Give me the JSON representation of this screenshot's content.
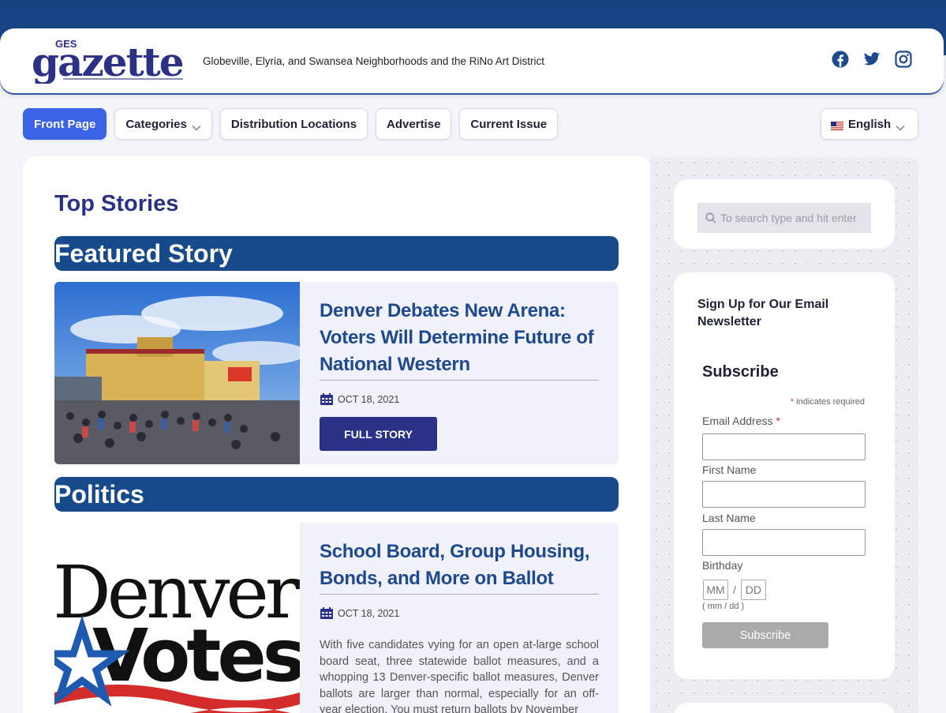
{
  "header": {
    "logo_small": "GES",
    "logo_text": "gazette",
    "tagline": "Globeville, Elyria, and Swansea Neighborhoods and the RiNo Art District",
    "social": [
      "facebook-icon",
      "twitter-icon",
      "instagram-icon"
    ]
  },
  "nav": {
    "items": [
      {
        "label": "Front Page",
        "active": true
      },
      {
        "label": "Categories",
        "dropdown": true
      },
      {
        "label": "Distribution Locations"
      },
      {
        "label": "Advertise"
      },
      {
        "label": "Current Issue"
      }
    ],
    "language": "English"
  },
  "main": {
    "heading": "Top Stories",
    "sections": [
      {
        "title": "Featured Story",
        "headline": "Denver Debates New Arena: Voters Will Determine Future of National Western",
        "date": "OCT 18, 2021",
        "button": "FULL STORY"
      },
      {
        "title": "Politics",
        "headline": "School Board, Group Housing, Bonds, and More on Ballot",
        "date": "OCT 18, 2021",
        "excerpt": "With five candidates vying for an open at-large school board seat, three statewide ballot measures, and a whopping 13 Denver-specific ballot measures, Denver ballots are larger than normal, especially for an off-year election. You must return ballots by November",
        "image_text_1": "Denver",
        "image_text_2": "Votes"
      }
    ]
  },
  "sidebar": {
    "search_placeholder": "To search type and hit enter",
    "newsletter_title": "Sign Up for Our Email Newsletter",
    "subscribe_heading": "Subscribe",
    "required_note": "indicates required",
    "fields": {
      "email": "Email Address",
      "first": "First Name",
      "last": "Last Name",
      "birthday": "Birthday",
      "mm": "MM",
      "dd": "DD",
      "hint": "( mm / dd )"
    },
    "subscribe_button": "Subscribe"
  },
  "colors": {
    "brand_navy": "#174a8b",
    "accent_blue": "#3b63e6",
    "headline_blue": "#1e4a8d",
    "button_indigo": "#2b3285"
  }
}
